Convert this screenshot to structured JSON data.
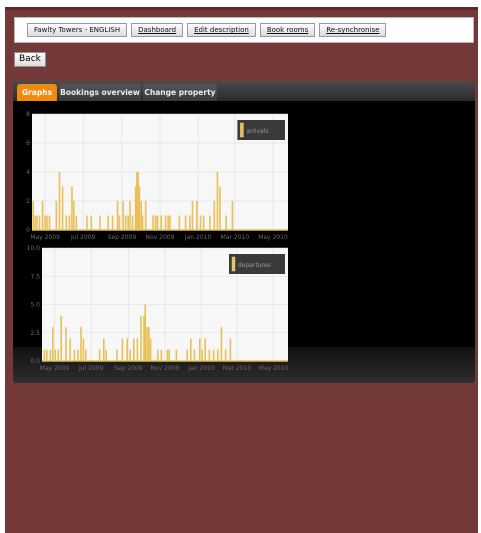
{
  "toolbar": {
    "buttons": [
      {
        "label": "Fawlty Towers - ENGLISH"
      },
      {
        "label": "Dashboard"
      },
      {
        "label": "Edit description"
      },
      {
        "label": "Book rooms"
      },
      {
        "label": "Re-synchronise"
      }
    ]
  },
  "back_label": "Back",
  "tabs": [
    {
      "label": "Graphs",
      "active": true
    },
    {
      "label": "Bookings overview",
      "active": false
    },
    {
      "label": "Change property",
      "active": false
    }
  ],
  "colors": {
    "background": "#733838",
    "accent": "#f08b12",
    "bar": "#e8c056"
  },
  "chart_data": [
    {
      "type": "bar",
      "series": [
        {
          "name": "arrivals"
        }
      ],
      "x_ticks": [
        "May 2009",
        "Jul 2009",
        "Sep 2009",
        "Nov 2009",
        "Jan 2010",
        "Mar 2010",
        "May 2010"
      ],
      "y_ticks": [
        "0",
        "2",
        "4",
        "6",
        "8"
      ],
      "ylim": [
        0,
        8
      ],
      "x_range": [
        "2009-04-10",
        "2010-05-25"
      ],
      "grid": true,
      "legend": "top-right",
      "points": [
        [
          "2009-04-12",
          2
        ],
        [
          "2009-04-15",
          1
        ],
        [
          "2009-04-18",
          1
        ],
        [
          "2009-04-22",
          1
        ],
        [
          "2009-04-27",
          2
        ],
        [
          "2009-05-01",
          1
        ],
        [
          "2009-05-04",
          1
        ],
        [
          "2009-05-08",
          1
        ],
        [
          "2009-05-19",
          2
        ],
        [
          "2009-05-24",
          4
        ],
        [
          "2009-05-29",
          3
        ],
        [
          "2009-06-04",
          1
        ],
        [
          "2009-06-09",
          1
        ],
        [
          "2009-06-13",
          3
        ],
        [
          "2009-06-16",
          2
        ],
        [
          "2009-06-20",
          1
        ],
        [
          "2009-07-07",
          1
        ],
        [
          "2009-07-14",
          1
        ],
        [
          "2009-07-28",
          1
        ],
        [
          "2009-08-10",
          1
        ],
        [
          "2009-08-17",
          1
        ],
        [
          "2009-08-25",
          2
        ],
        [
          "2009-08-28",
          1
        ],
        [
          "2009-09-03",
          2
        ],
        [
          "2009-09-07",
          1
        ],
        [
          "2009-09-11",
          1
        ],
        [
          "2009-09-14",
          2
        ],
        [
          "2009-09-18",
          1
        ],
        [
          "2009-09-23",
          3
        ],
        [
          "2009-09-25",
          4
        ],
        [
          "2009-09-27",
          4
        ],
        [
          "2009-09-29",
          3
        ],
        [
          "2009-10-02",
          2
        ],
        [
          "2009-10-04",
          1
        ],
        [
          "2009-10-09",
          2
        ],
        [
          "2009-10-21",
          1
        ],
        [
          "2009-10-25",
          1
        ],
        [
          "2009-10-28",
          1
        ],
        [
          "2009-11-03",
          1
        ],
        [
          "2009-11-10",
          1
        ],
        [
          "2009-11-14",
          1
        ],
        [
          "2009-11-17",
          1
        ],
        [
          "2009-12-02",
          1
        ],
        [
          "2009-12-12",
          1
        ],
        [
          "2009-12-19",
          1
        ],
        [
          "2009-12-23",
          2
        ],
        [
          "2009-12-30",
          2
        ],
        [
          "2010-01-05",
          1
        ],
        [
          "2010-01-10",
          1
        ],
        [
          "2010-01-20",
          1
        ],
        [
          "2010-01-27",
          2
        ],
        [
          "2010-02-01",
          4
        ],
        [
          "2010-02-05",
          3
        ],
        [
          "2010-02-15",
          1
        ],
        [
          "2010-02-25",
          2
        ]
      ]
    },
    {
      "type": "bar",
      "series": [
        {
          "name": "departures"
        }
      ],
      "x_ticks": [
        "May 2009",
        "Jul 2009",
        "Sep 2009",
        "Nov 2009",
        "Jan 2010",
        "Mar 2010",
        "May 2010"
      ],
      "y_ticks": [
        "0.0",
        "2.5",
        "5.0",
        "7.5",
        "10.0"
      ],
      "ylim": [
        0,
        10
      ],
      "x_range": [
        "2009-04-10",
        "2010-05-25"
      ],
      "grid": true,
      "legend": "top-right",
      "points": [
        [
          "2009-04-14",
          1
        ],
        [
          "2009-04-18",
          1
        ],
        [
          "2009-04-24",
          1
        ],
        [
          "2009-04-28",
          3
        ],
        [
          "2009-05-02",
          1
        ],
        [
          "2009-05-07",
          1
        ],
        [
          "2009-05-12",
          4
        ],
        [
          "2009-05-20",
          3
        ],
        [
          "2009-05-27",
          2
        ],
        [
          "2009-06-03",
          1
        ],
        [
          "2009-06-09",
          1
        ],
        [
          "2009-06-14",
          3
        ],
        [
          "2009-06-18",
          2
        ],
        [
          "2009-06-22",
          1
        ],
        [
          "2009-07-15",
          1
        ],
        [
          "2009-07-22",
          2
        ],
        [
          "2009-07-26",
          1
        ],
        [
          "2009-08-13",
          1
        ],
        [
          "2009-08-22",
          2
        ],
        [
          "2009-08-30",
          2
        ],
        [
          "2009-09-04",
          1
        ],
        [
          "2009-09-10",
          2
        ],
        [
          "2009-09-16",
          2
        ],
        [
          "2009-09-22",
          4
        ],
        [
          "2009-09-27",
          4
        ],
        [
          "2009-09-29",
          5
        ],
        [
          "2009-10-02",
          3
        ],
        [
          "2009-10-05",
          3
        ],
        [
          "2009-10-08",
          2
        ],
        [
          "2009-10-20",
          1
        ],
        [
          "2009-10-26",
          1
        ],
        [
          "2009-11-05",
          1
        ],
        [
          "2009-11-08",
          1
        ],
        [
          "2009-11-20",
          1
        ],
        [
          "2009-12-08",
          1
        ],
        [
          "2009-12-14",
          2
        ],
        [
          "2009-12-20",
          1
        ],
        [
          "2009-12-29",
          2
        ],
        [
          "2010-01-02",
          1
        ],
        [
          "2010-01-07",
          2
        ],
        [
          "2010-01-14",
          1
        ],
        [
          "2010-01-21",
          1
        ],
        [
          "2010-01-28",
          1
        ],
        [
          "2010-02-03",
          3
        ],
        [
          "2010-02-10",
          1
        ],
        [
          "2010-02-18",
          2
        ]
      ]
    }
  ]
}
